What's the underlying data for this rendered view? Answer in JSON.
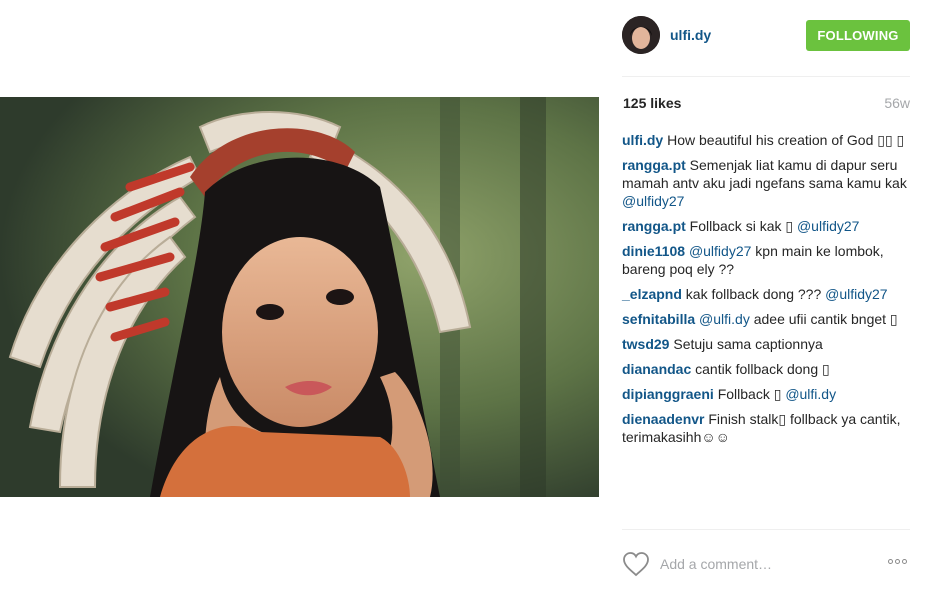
{
  "post": {
    "username": "ulfi.dy",
    "follow_label": "FOLLOWING",
    "likes": "125 likes",
    "age": "56w"
  },
  "comments": [
    {
      "user": "ulfi.dy",
      "parts": [
        {
          "t": "How beautiful his creation of God ▯▯ ▯"
        }
      ]
    },
    {
      "user": "rangga.pt",
      "parts": [
        {
          "t": "Semenjak liat kamu di dapur seru mamah antv aku jadi ngefans sama kamu kak "
        },
        {
          "m": "@ulfidy27"
        }
      ]
    },
    {
      "user": "rangga.pt",
      "parts": [
        {
          "t": "Follback si kak ▯ "
        },
        {
          "m": "@ulfidy27"
        }
      ]
    },
    {
      "user": "dinie1108",
      "parts": [
        {
          "m": "@ulfidy27"
        },
        {
          "t": " kpn main ke lombok, bareng poq ely ??"
        }
      ]
    },
    {
      "user": "_elzapnd",
      "parts": [
        {
          "t": "kak follback dong ??? "
        },
        {
          "m": "@ulfidy27"
        }
      ]
    },
    {
      "user": "sefnitabilla",
      "parts": [
        {
          "m": "@ulfi.dy"
        },
        {
          "t": " adee ufii cantik bnget ▯"
        }
      ]
    },
    {
      "user": "twsd29",
      "parts": [
        {
          "t": "Setuju sama captionnya"
        }
      ]
    },
    {
      "user": "dianandac",
      "parts": [
        {
          "t": "cantik follback dong ▯"
        }
      ]
    },
    {
      "user": "dipianggraeni",
      "parts": [
        {
          "t": "Follback ▯ "
        },
        {
          "m": "@ulfi.dy"
        }
      ]
    },
    {
      "user": "dienaadenvr",
      "parts": [
        {
          "t": "Finish stalk▯ follback ya cantik, terimakasihh☺☺"
        }
      ]
    }
  ],
  "footer": {
    "comment_placeholder": "Add a comment…",
    "like_icon": "heart-outline-icon",
    "more_icon": "more-options-icon"
  },
  "colors": {
    "link": "#125688",
    "follow_button": "#6bc23e",
    "muted": "#a5a7aa"
  }
}
